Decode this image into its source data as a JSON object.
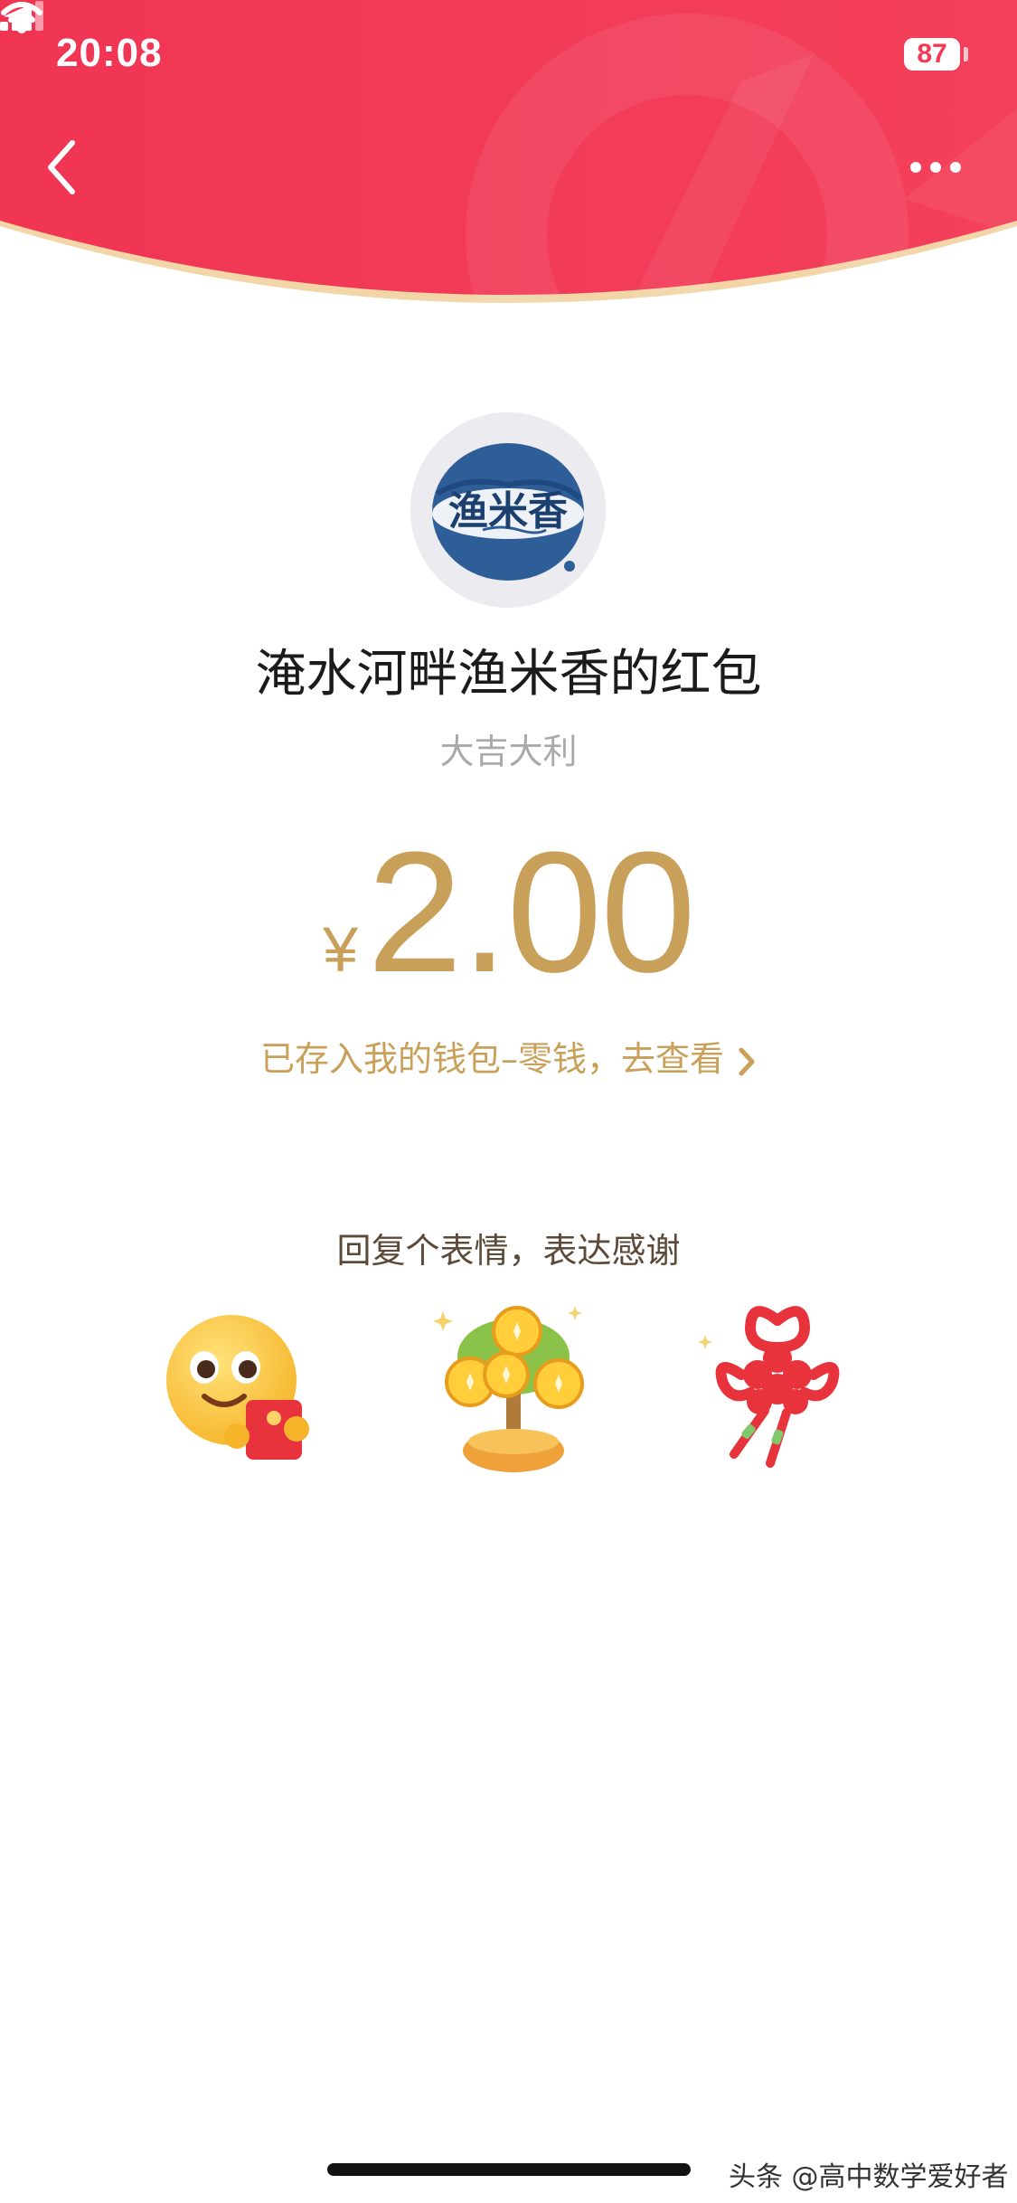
{
  "status_bar": {
    "time": "20:08",
    "battery": "87",
    "icons": [
      "location-arrow-icon",
      "cellular-signal-icon",
      "wifi-icon",
      "battery-icon"
    ]
  },
  "nav": {
    "back_icon": "chevron-left-icon",
    "more_icon": "more-dots-icon"
  },
  "sender": {
    "avatar_text": "渔米香",
    "title": "淹水河畔渔米香的红包",
    "greeting": "大吉大利"
  },
  "amount": {
    "currency": "¥",
    "value": "2.00"
  },
  "wallet_link": {
    "label": "已存入我的钱包–零钱，去查看"
  },
  "reply": {
    "prompt": "回复个表情，表达感谢",
    "stickers": [
      "smiley-red-envelope-sticker",
      "money-tree-sticker",
      "chinese-knot-sticker"
    ]
  },
  "watermark": "头条 @高中数学爱好者",
  "colors": {
    "header_red": "#f23a56",
    "gold": "#c9a059",
    "header_edge": "#f2d6a8"
  }
}
